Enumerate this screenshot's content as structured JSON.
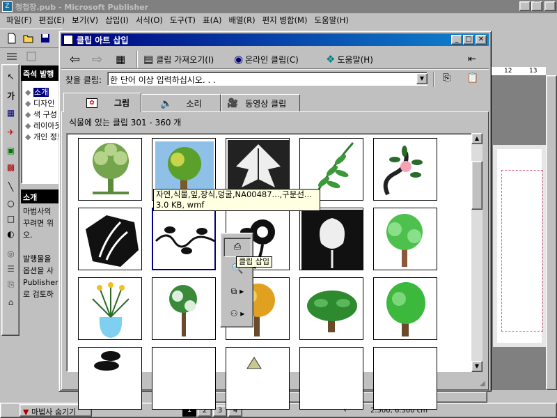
{
  "window": {
    "title": "청첩장.pub - Microsoft Publisher",
    "icon_label": "Z"
  },
  "menu": [
    "파일(F)",
    "편집(E)",
    "보기(V)",
    "삽입(I)",
    "서식(O)",
    "도구(T)",
    "표(A)",
    "배열(R)",
    "편지 병합(M)",
    "도움말(H)"
  ],
  "wizard": {
    "header": "즉석 발행",
    "items": [
      "소개",
      "디자인",
      "색 구성",
      "레이아웃",
      "개인 정보"
    ],
    "intro_header": "소개",
    "intro_lines": [
      "마법사의",
      "꾸려면 위",
      "오.",
      "",
      "발행물을",
      "옵션을 사",
      "Publisher",
      "로 검토하"
    ],
    "hide_button": "마법사 숨기기"
  },
  "status": {
    "pages": [
      "1",
      "2",
      "3",
      "4"
    ],
    "coords": "2.500, 6.300 cm"
  },
  "ruler": {
    "marks": [
      "12",
      "13"
    ]
  },
  "dialog": {
    "title": "클립 아트 삽입",
    "toolbar": {
      "import": "클립 가져오기(I)",
      "online": "온라인 클립(C)",
      "help": "도움말(H)"
    },
    "search": {
      "label": "찾을 클립:",
      "placeholder": "한 단어 이상 입력하십시오. . ."
    },
    "tabs": [
      "그림",
      "소리",
      "동영상 클립"
    ],
    "range_text": "식물에 있는 클립 301 - 360 개",
    "tooltip": {
      "line1": "자연,식물,잎,장식,덩굴,NA00487...,구분선...",
      "line2": "3.0 KB, wmf"
    },
    "insert_tip": "클립 삽입"
  }
}
